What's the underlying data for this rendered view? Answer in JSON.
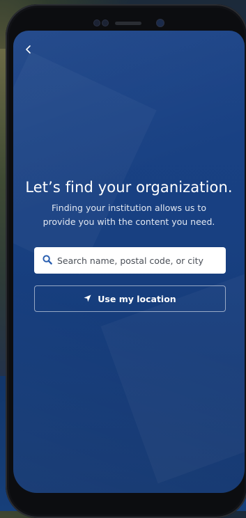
{
  "screen": {
    "back_icon": "chevron-left-icon",
    "title": "Let’s find your organization.",
    "subtitle": "Finding your institution allows us to provide you with the content you need."
  },
  "search": {
    "icon": "search-icon",
    "placeholder": "Search name, postal code, or city",
    "value": ""
  },
  "location_button": {
    "icon": "location-arrow-icon",
    "label": "Use my location"
  },
  "colors": {
    "screen_bg": "#184081",
    "accent_icon": "#2a5fb0",
    "text": "#ffffff"
  }
}
